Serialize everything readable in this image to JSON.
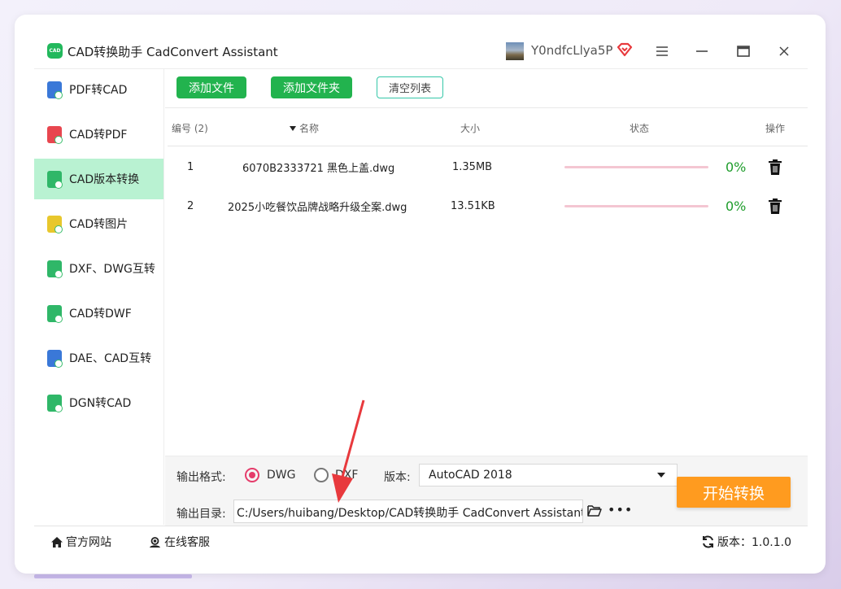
{
  "window": {
    "logo_text": "CAD",
    "title": "CAD转换助手 CadConvert Assistant",
    "username": "Y0ndfcLlya5P",
    "controls": [
      "menu-icon",
      "minimize-icon",
      "maximize-icon",
      "close-icon"
    ]
  },
  "sidebar": {
    "items": [
      {
        "label": "PDF转CAD",
        "icon": "pdf-to-cad-icon",
        "active": false
      },
      {
        "label": "CAD转PDF",
        "icon": "cad-to-pdf-icon",
        "active": false
      },
      {
        "label": "CAD版本转换",
        "icon": "cad-version-icon",
        "active": true
      },
      {
        "label": "CAD转图片",
        "icon": "cad-to-image-icon",
        "active": false
      },
      {
        "label": "DXF、DWG互转",
        "icon": "dxf-dwg-icon",
        "active": false
      },
      {
        "label": "CAD转DWF",
        "icon": "cad-to-dwf-icon",
        "active": false
      },
      {
        "label": "DAE、CAD互转",
        "icon": "dae-cad-icon",
        "active": false
      },
      {
        "label": "DGN转CAD",
        "icon": "dgn-to-cad-icon",
        "active": false
      }
    ]
  },
  "toolbar": {
    "add_file": "添加文件",
    "add_folder": "添加文件夹",
    "clear_list": "清空列表"
  },
  "table": {
    "headers": {
      "index": "编号 (2)",
      "name": "名称",
      "size": "大小",
      "status": "状态",
      "action": "操作"
    },
    "rows": [
      {
        "index": "1",
        "name": "6070B2333721 黑色上盖.dwg",
        "size": "1.35MB",
        "progress": 0,
        "percent": "0%"
      },
      {
        "index": "2",
        "name": "2025小吃餐饮品牌战略升级全案.dwg",
        "size": "13.51KB",
        "progress": 0,
        "percent": "0%"
      }
    ]
  },
  "options": {
    "format_label": "输出格式:",
    "format_options": [
      "DWG",
      "DXF"
    ],
    "format_selected": "DWG",
    "version_label": "版本:",
    "version_value": "AutoCAD 2018",
    "dir_label": "输出目录:",
    "dir_value": "C:/Users/huibang/Desktop/CAD转换助手 CadConvert Assistant",
    "more": "•••"
  },
  "start_button": "开始转换",
  "footer": {
    "website": "官方网站",
    "support": "在线客服",
    "version": "版本：1.0.1.0"
  },
  "colors": {
    "accent_green": "#22b34e",
    "active_bg": "#b9f2d2",
    "start_orange": "#ff9b1f",
    "radio_pink": "#e53c6b",
    "percent_green": "#1f9d2c",
    "annotation_red": "#e8393d"
  }
}
